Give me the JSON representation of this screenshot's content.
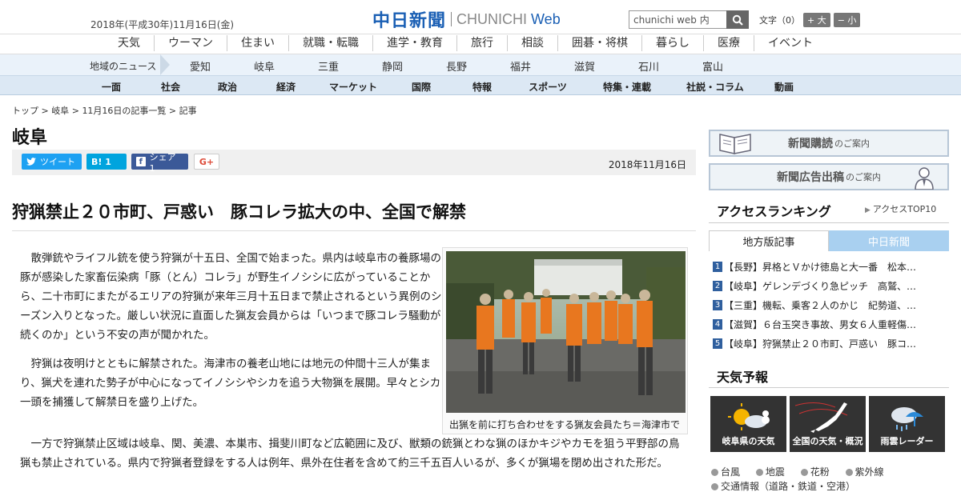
{
  "header": {
    "date": "2018年(平成30年)11月16日(金)",
    "logo_kanji": "中日新聞",
    "logo_latin": "CHUNICHI",
    "logo_web": "Web",
    "search_value": "chunichi web 内",
    "fontsize_label": "文字（0）",
    "font_larger": "+ 大",
    "font_smaller": "− 小"
  },
  "category_nav": [
    "天気",
    "ウーマン",
    "住まい",
    "就職・転職",
    "進学・教育",
    "旅行",
    "相談",
    "囲碁・将棋",
    "暮らし",
    "医療",
    "イベント"
  ],
  "region_nav": {
    "label": "地域のニュース",
    "items": [
      "愛知",
      "岐阜",
      "三重",
      "静岡",
      "長野",
      "福井",
      "滋賀",
      "石川",
      "富山"
    ]
  },
  "section_nav": [
    "一面",
    "社会",
    "政治",
    "経済",
    "マーケット",
    "国際",
    "特報",
    "スポーツ",
    "特集・連載",
    "社説・コラム",
    "動画"
  ],
  "breadcrumb": {
    "top": "トップ",
    "gifu": "岐阜",
    "list": "11月16日の記事一覧",
    "current": "記事"
  },
  "section_title": "岐阜",
  "share": {
    "tweet": "ツイート",
    "hatena": "B! 1",
    "facebook": "シェア 1",
    "gplus": "G+",
    "pub_date": "2018年11月16日"
  },
  "article": {
    "headline": "狩猟禁止２０市町、戸惑い　豚コレラ拡大の中、全国で解禁",
    "para1": "散弾銃やライフル銃を使う狩猟が十五日、全国で始まった。県内は岐阜市の養豚場の豚が感染した家畜伝染病「豚（とん）コレラ」が野生イノシシに広がっていることから、二十市町にまたがるエリアの狩猟が来年三月十五日まで禁止されるという異例のシーズン入りとなった。厳しい状況に直面した猟友会員からは「いつまで豚コレラ騒動が続くのか」という不安の声が聞かれた。",
    "para2": "狩猟は夜明けとともに解禁された。海津市の養老山地には地元の仲間十三人が集まり、猟犬を連れた勢子が中心になってイノシシやシカを追う大物猟を展開。早々とシカ一頭を捕獲して解禁日を盛り上げた。",
    "para3": "一方で狩猟禁止区域は岐阜、関、美濃、本巣市、揖斐川町など広範囲に及び、獣類の銃猟とわな猟のほかキジやカモを狙う平野部の鳥猟も禁止されている。県内で狩猟者登録をする人は例年、県外在住者を含めて約三千五百人いるが、多くが猟場を閉め出された形だ。",
    "photo_caption": "出猟を前に打ち合わせをする猟友会員たち＝海津市で"
  },
  "sidebar": {
    "banner_subscribe": "新聞購読",
    "banner_subscribe_small": "のご案内",
    "banner_ads": "新聞広告出稿",
    "banner_ads_small": "のご案内",
    "ranking_title": "アクセスランキング",
    "ranking_link": "アクセスTOP10",
    "tab_regional": "地方版記事",
    "tab_chunichi": "中日新聞",
    "ranking": [
      {
        "num": "1",
        "text": "【長野】昇格とＶかけ徳島と大一番　松本…"
      },
      {
        "num": "2",
        "text": "【岐阜】ゲレンデづくり急ピッチ　高鷲、…"
      },
      {
        "num": "3",
        "text": "【三重】機転、乗客２人のかじ　紀勢道、…"
      },
      {
        "num": "4",
        "text": "【滋賀】６台玉突き事故、男女６人重軽傷…"
      },
      {
        "num": "5",
        "text": "【岐阜】狩猟禁止２０市町、戸惑い　豚コ…"
      }
    ],
    "weather_title": "天気予報",
    "weather_boxes": [
      "岐阜県の天気",
      "全国の天気・概況",
      "雨雲レーダー"
    ],
    "weather_links": [
      "台風",
      "地震",
      "花粉",
      "紫外線",
      "交通情報（道路・鉄道・空港）"
    ]
  }
}
